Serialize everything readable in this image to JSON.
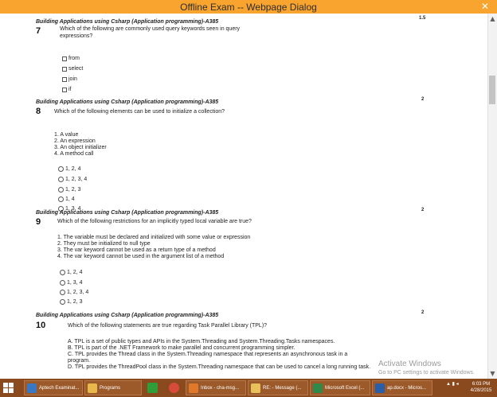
{
  "window": {
    "title": "Offline Exam -- Webpage Dialog",
    "close_icon": "close-icon"
  },
  "questions": [
    {
      "course": "Building Applications using Csharp (Application programming)-A385",
      "number": "7",
      "marks": "1.5",
      "text": "Which of the following are commonly used query keywords seen in query expressions?",
      "items": [],
      "option_type": "checkbox",
      "options": [
        "from",
        "select",
        "join",
        "if"
      ]
    },
    {
      "course": "Building Applications using Csharp (Application programming)-A385",
      "number": "8",
      "marks": "2",
      "text": "Which of the following elements can be used to initialize a collection?",
      "items": [
        "1. A value",
        "2. An expression",
        "3. An object initializer",
        "4. A method call"
      ],
      "option_type": "radio",
      "options": [
        "1, 2, 4",
        "1, 2, 3, 4",
        "1, 2, 3",
        "1, 4",
        "1, 3, 4"
      ]
    },
    {
      "course": "Building Applications using Csharp (Application programming)-A385",
      "number": "9",
      "marks": "2",
      "text": "Which of the following restrictions for an implicitly typed local variable are true?",
      "items": [
        "1. The variable must be declared and initialized with some value or expression",
        "2. They must be initialized to null type",
        "3. The var keyword cannot be used as a return type of a method",
        "4. The var keyword cannot be used in the argument list of a method"
      ],
      "option_type": "radio",
      "options": [
        "1, 2, 4",
        "1, 3, 4",
        "1, 2, 3, 4",
        "1, 2, 3"
      ]
    },
    {
      "course": "Building Applications using Csharp (Application programming)-A385",
      "number": "10",
      "marks": "2",
      "text": "Which of the following statements are true regarding Task Parallel Library (TPL)?",
      "items": [
        "A. TPL is a set of public types and APIs in the System.Threading and System.Threading.Tasks namespaces.",
        "B. TPL is part of the .NET Framework to make parallel and concurrent programming simpler.",
        "C. TPL provides the Thread class in the System.Threading namespace that represents an asynchronous task in a",
        "program.",
        "D. TPL provides the ThreadPool class in the System.Threading namespace that can be used to cancel a long running task."
      ],
      "option_type": "radio",
      "options": []
    }
  ],
  "watermark": {
    "title": "Activate Windows",
    "subtitle": "Go to PC settings to activate Windows."
  },
  "taskbar": {
    "items": [
      {
        "label": "Aptech Examinat...",
        "icon": "browser-icon",
        "color": "#3a78c4"
      },
      {
        "label": "Programs",
        "icon": "folder-icon",
        "color": "#e8b84a"
      },
      {
        "label": "",
        "icon": "store-icon",
        "color": "#2f9e3a"
      },
      {
        "label": "",
        "icon": "chrome-icon",
        "color": "#d84a3a"
      },
      {
        "label": "Inbox - cha-msg...",
        "icon": "outlook-icon",
        "color": "#e0782a"
      },
      {
        "label": "RE: - Message (...",
        "icon": "mail-icon",
        "color": "#e8c15a"
      },
      {
        "label": "Microsoft Excel (...",
        "icon": "excel-icon",
        "color": "#2f8a4a"
      },
      {
        "label": "ap.docx - Micros...",
        "icon": "word-icon",
        "color": "#2a5ea8"
      }
    ],
    "clock_time": "6:03 PM",
    "clock_date": "4/28/2015"
  }
}
